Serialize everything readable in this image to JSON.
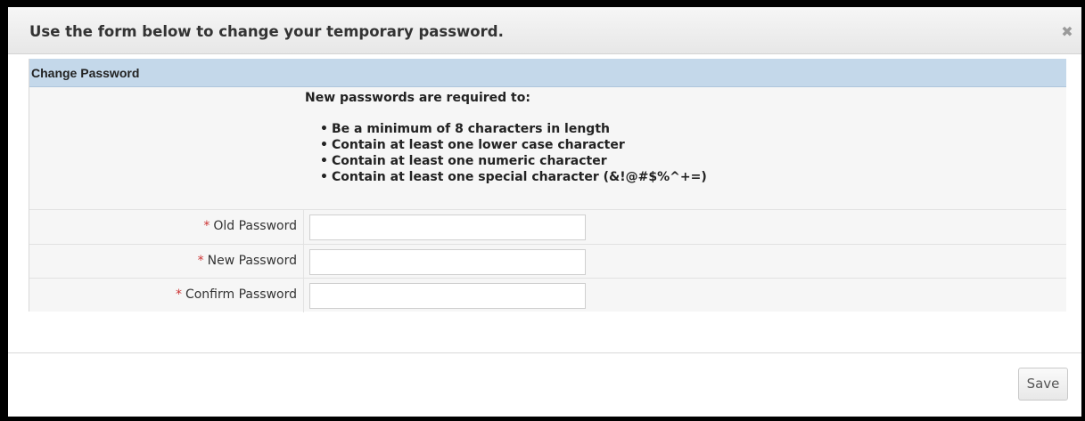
{
  "dialog": {
    "title": "Use the form below to change your temporary password.",
    "close_glyph": "✖",
    "close_icon": "close-icon"
  },
  "panel": {
    "header": "Change Password",
    "requirements_heading": "New passwords are required to:",
    "requirements": [
      "Be a minimum of 8 characters in length",
      "Contain at least one lower case character",
      "Contain at least one numeric character",
      "Contain at least one special character (&!@#$%^+=)"
    ]
  },
  "form": {
    "required_marker": "*",
    "fields": [
      {
        "label": "Old Password",
        "value": "",
        "type": "password"
      },
      {
        "label": "New Password",
        "value": "",
        "type": "password"
      },
      {
        "label": "Confirm Password",
        "value": "",
        "type": "password"
      }
    ]
  },
  "footer": {
    "save_label": "Save"
  },
  "colors": {
    "panel_header_bg": "#c4d8ea",
    "required_marker": "#cc3333",
    "page_background": "#000000"
  }
}
